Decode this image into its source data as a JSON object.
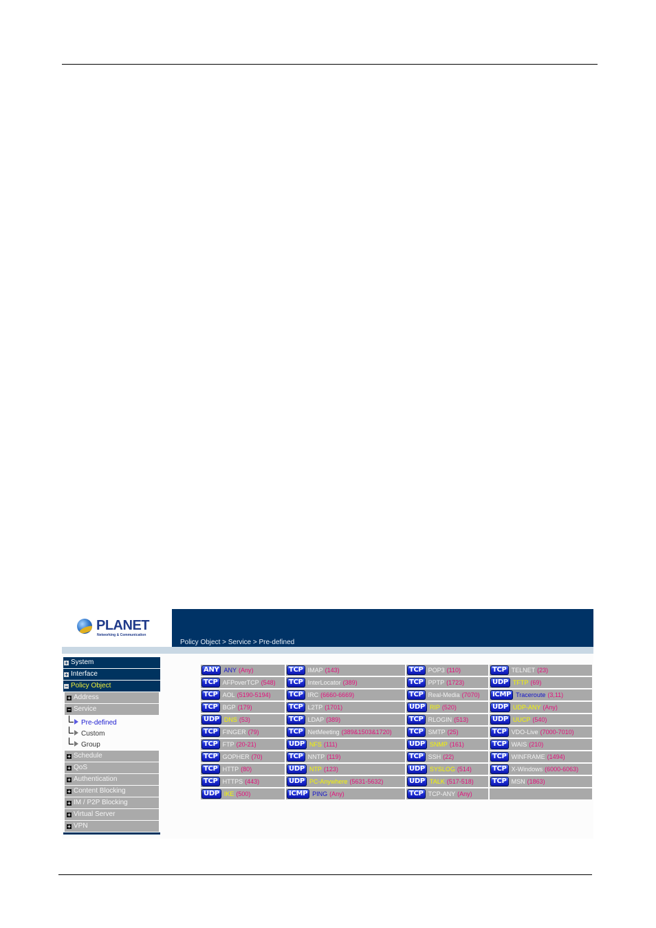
{
  "logo": {
    "brand": "PLANET",
    "tagline": "Networking & Communication"
  },
  "breadcrumb": "Policy Object > Service > Pre-defined",
  "sidebar": {
    "main_top": [
      {
        "label": "System",
        "expanded": false
      },
      {
        "label": "Interface",
        "expanded": false
      },
      {
        "label": "Policy Object",
        "expanded": true,
        "active": true
      }
    ],
    "sub": [
      {
        "label": "Address",
        "expanded": false
      },
      {
        "label": "Service",
        "expanded": true
      }
    ],
    "leaves": [
      {
        "label": "Pre-defined",
        "active": true
      },
      {
        "label": "Custom",
        "active": false
      },
      {
        "label": "Group",
        "active": false
      }
    ],
    "sub_bottom": [
      {
        "label": "Schedule"
      },
      {
        "label": "QoS"
      },
      {
        "label": "Authentication"
      },
      {
        "label": "Content Blocking"
      },
      {
        "label": "IM / P2P Blocking"
      },
      {
        "label": "Virtual Server"
      },
      {
        "label": "VPN"
      }
    ]
  },
  "colors": {
    "header_bg": "#003366",
    "subbar_bg": "#c9d8e4",
    "cell_bg": "#a9a9a9",
    "tcp_name": "#f2f2f2",
    "udp_name": "#f5f500",
    "icmp_any_name": "#1414c8",
    "port": "#e4107c",
    "active_nav": "#f2ee3a"
  },
  "services": [
    [
      {
        "proto": "ANY",
        "name": "ANY",
        "port": "(Any)"
      },
      {
        "proto": "TCP",
        "name": "IMAP",
        "port": "(143)"
      },
      {
        "proto": "TCP",
        "name": "POP3",
        "port": "(110)"
      },
      {
        "proto": "TCP",
        "name": "TELNET",
        "port": "(23)"
      }
    ],
    [
      {
        "proto": "TCP",
        "name": "AFPoverTCP",
        "port": "(548)"
      },
      {
        "proto": "TCP",
        "name": "InterLocator",
        "port": "(389)"
      },
      {
        "proto": "TCP",
        "name": "PPTP",
        "port": "(1723)"
      },
      {
        "proto": "UDP",
        "name": "TFTP",
        "port": "(69)"
      }
    ],
    [
      {
        "proto": "TCP",
        "name": "AOL",
        "port": "(5190-5194)"
      },
      {
        "proto": "TCP",
        "name": "IRC",
        "port": "(6660-6669)"
      },
      {
        "proto": "TCP",
        "name": "Real-Media",
        "port": "(7070)"
      },
      {
        "proto": "ICMP",
        "name": "Traceroute",
        "port": "(3,11)"
      }
    ],
    [
      {
        "proto": "TCP",
        "name": "BGP",
        "port": "(179)"
      },
      {
        "proto": "TCP",
        "name": "L2TP",
        "port": "(1701)"
      },
      {
        "proto": "UDP",
        "name": "RIP",
        "port": "(520)"
      },
      {
        "proto": "UDP",
        "name": "UDP-ANY",
        "port": "(Any)"
      }
    ],
    [
      {
        "proto": "UDP",
        "name": "DNS",
        "port": "(53)"
      },
      {
        "proto": "TCP",
        "name": "LDAP",
        "port": "(389)"
      },
      {
        "proto": "TCP",
        "name": "RLOGIN",
        "port": "(513)"
      },
      {
        "proto": "UDP",
        "name": "UUCP",
        "port": "(540)"
      }
    ],
    [
      {
        "proto": "TCP",
        "name": "FINGER",
        "port": "(79)"
      },
      {
        "proto": "TCP",
        "name": "NetMeeting",
        "port": "(389&1503&1720)"
      },
      {
        "proto": "TCP",
        "name": "SMTP",
        "port": "(25)"
      },
      {
        "proto": "TCP",
        "name": "VDO-Live",
        "port": "(7000-7010)"
      }
    ],
    [
      {
        "proto": "TCP",
        "name": "FTP",
        "port": "(20-21)"
      },
      {
        "proto": "UDP",
        "name": "NFS",
        "port": "(111)"
      },
      {
        "proto": "UDP",
        "name": "SNMP",
        "port": "(161)"
      },
      {
        "proto": "TCP",
        "name": "WAIS",
        "port": "(210)"
      }
    ],
    [
      {
        "proto": "TCP",
        "name": "GOPHER",
        "port": "(70)"
      },
      {
        "proto": "TCP",
        "name": "NNTP",
        "port": "(119)"
      },
      {
        "proto": "TCP",
        "name": "SSH",
        "port": "(22)"
      },
      {
        "proto": "TCP",
        "name": "WINFRAME",
        "port": "(1494)"
      }
    ],
    [
      {
        "proto": "TCP",
        "name": "HTTP",
        "port": "(80)"
      },
      {
        "proto": "UDP",
        "name": "NTP",
        "port": "(123)"
      },
      {
        "proto": "UDP",
        "name": "SYSLOG",
        "port": "(514)"
      },
      {
        "proto": "TCP",
        "name": "X-Windows",
        "port": "(6000-6063)"
      }
    ],
    [
      {
        "proto": "TCP",
        "name": "HTTPS",
        "port": "(443)"
      },
      {
        "proto": "UDP",
        "name": "PC-Anywhere",
        "port": "(5631-5632)"
      },
      {
        "proto": "UDP",
        "name": "TALK",
        "port": "(517-518)"
      },
      {
        "proto": "TCP",
        "name": "MSN",
        "port": "(1863)"
      }
    ],
    [
      {
        "proto": "UDP",
        "name": "IKE",
        "port": "(500)"
      },
      {
        "proto": "ICMP",
        "name": "PING",
        "port": "(Any)"
      },
      {
        "proto": "TCP",
        "name": "TCP-ANY",
        "port": "(Any)"
      },
      null
    ]
  ]
}
